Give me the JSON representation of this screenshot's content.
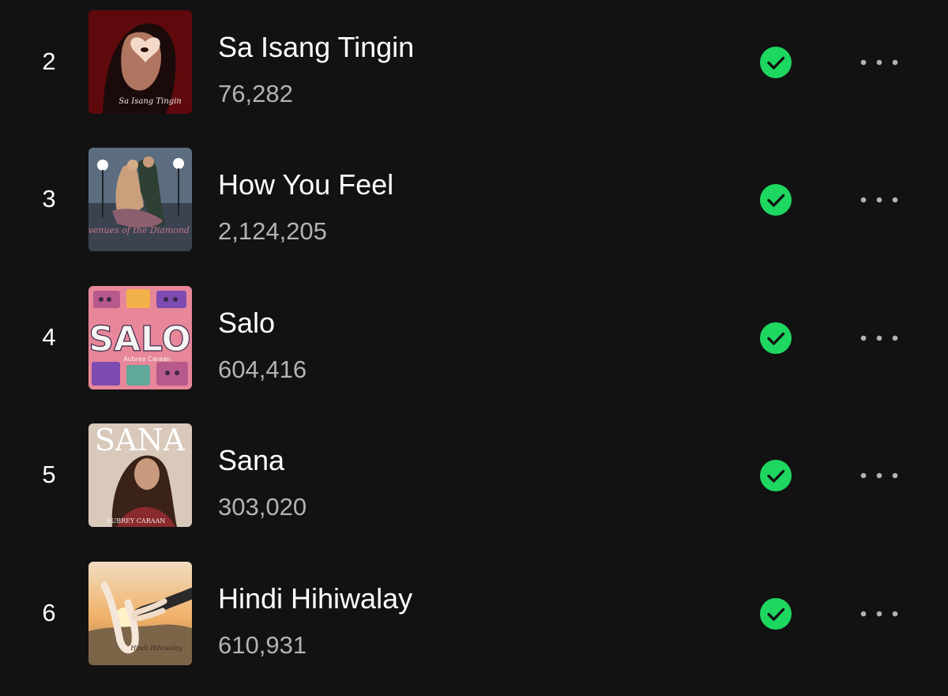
{
  "tracks": [
    {
      "rank": "2",
      "title": "Sa Isang Tingin",
      "streams": "76,282",
      "saved": true,
      "cover": {
        "icon": "sa-isang-tingin-cover-art",
        "text": "Sa Isang Tingin"
      }
    },
    {
      "rank": "3",
      "title": "How You Feel",
      "streams": "2,124,205",
      "saved": true,
      "cover": {
        "icon": "avenues-of-the-diamond-cover-art",
        "text": "Avenues of the Diamond"
      }
    },
    {
      "rank": "4",
      "title": "Salo",
      "streams": "604,416",
      "saved": true,
      "cover": {
        "icon": "salo-cover-art",
        "text": "SALO",
        "subtext": "Aubrey Caraan"
      }
    },
    {
      "rank": "5",
      "title": "Sana",
      "streams": "303,020",
      "saved": true,
      "cover": {
        "icon": "sana-cover-art",
        "text": "SANA",
        "subtext": "AUBREY CARAAN"
      }
    },
    {
      "rank": "6",
      "title": "Hindi Hihiwalay",
      "streams": "610,931",
      "saved": true,
      "cover": {
        "icon": "hindi-hihiwalay-cover-art",
        "text": "Hindi Hihiwalay"
      }
    }
  ],
  "icons": {
    "saved": "check-circle-icon",
    "more": "more-options-icon"
  },
  "colors": {
    "background": "#121212",
    "primary_text": "#ffffff",
    "secondary_text": "#b3b3b3",
    "accent": "#1ed760"
  }
}
